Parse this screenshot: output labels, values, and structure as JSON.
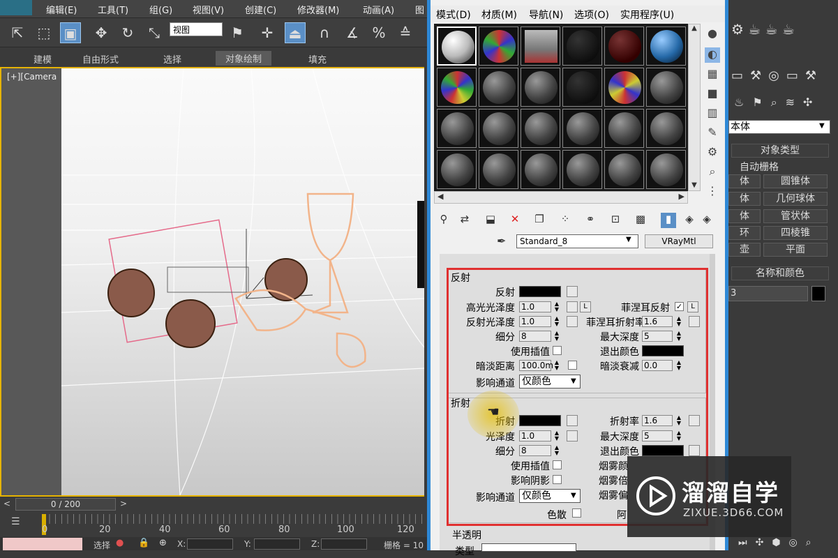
{
  "app": {
    "menu": [
      "编辑(E)",
      "工具(T)",
      "组(G)",
      "视图(V)",
      "创建(C)",
      "修改器(M)",
      "动画(A)",
      "图"
    ],
    "view_select": "视图",
    "ribbon_tabs": [
      "建模",
      "自由形式",
      "选择",
      "对象绘制",
      "填充"
    ],
    "ribbon_selected": "对象绘制",
    "viewport_label": "[+][Camera",
    "frame_counter": "0 / 200",
    "timeline_ticks": [
      "0",
      "20",
      "40",
      "60",
      "80",
      "100",
      "120"
    ],
    "status": {
      "select_label": "选择",
      "x": "X:",
      "y": "Y:",
      "z": "Z:",
      "grid": "栅格 = 10"
    }
  },
  "material_editor": {
    "menu": [
      "模式(D)",
      "材质(M)",
      "导航(N)",
      "选项(O)",
      "实用程序(U)"
    ],
    "material_name": "Standard_8",
    "material_type": "VRayMtl",
    "reflection": {
      "title": "反射",
      "reflect_label": "反射",
      "hilight_gloss_label": "高光光泽度",
      "hilight_gloss": "1.0",
      "refl_gloss_label": "反射光泽度",
      "refl_gloss": "1.0",
      "subdivs_label": "细分",
      "subdivs": "8",
      "use_interp_label": "使用插值",
      "dim_dist_label": "暗淡距离",
      "dim_dist": "100.0m",
      "affect_channels_label": "影响通道",
      "affect_channels": "仅颜色",
      "fresnel_label": "菲涅耳反射",
      "fresnel_checked": "✓",
      "fresnel_ior_label": "菲涅耳折射率",
      "fresnel_ior": "1.6",
      "max_depth_label": "最大深度",
      "max_depth": "5",
      "exit_color_label": "退出颜色",
      "dim_falloff_label": "暗淡衰减",
      "dim_falloff": "0.0",
      "lock_label": "L"
    },
    "refraction": {
      "title": "折射",
      "refract_label": "折射",
      "gloss_label": "光泽度",
      "gloss": "1.0",
      "subdivs_label": "细分",
      "subdivs": "8",
      "use_interp_label": "使用插值",
      "affect_shadows_label": "影响阴影",
      "affect_channels_label": "影响通道",
      "affect_channels": "仅颜色",
      "dispersion_label": "色散",
      "ior_label": "折射率",
      "ior": "1.6",
      "max_depth_label": "最大深度",
      "max_depth": "5",
      "exit_color_label": "退出颜色",
      "fog_color_label": "烟雾颜",
      "fog_mult_label": "烟雾倍",
      "fog_bias_label": "烟雾偏",
      "abbe_label": "阿"
    },
    "translucency": {
      "title": "半透明",
      "type_label": "类型"
    }
  },
  "command_panel": {
    "category_dropdown": "本体",
    "object_type_title": "对象类型",
    "autogrid_label": "自动栅格",
    "buttons": [
      "体",
      "圆锥体",
      "体",
      "几何球体",
      "体",
      "管状体",
      "环",
      "四棱锥",
      "壶",
      "平面"
    ],
    "name_color_title": "名称和颜色",
    "name_value": "3"
  },
  "watermark": {
    "brand": "溜溜自学",
    "url": "ZIXUE.3D66.COM"
  },
  "colors": {
    "accent": "#2e88d6",
    "highlight": "#e03030",
    "viewport_border": "#e6b300"
  }
}
